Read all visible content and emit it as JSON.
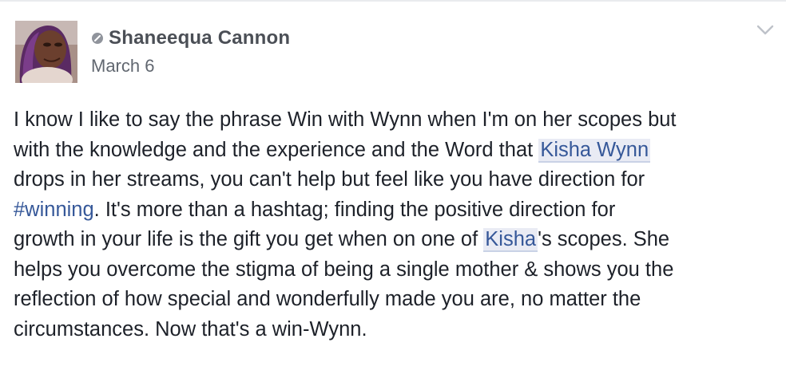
{
  "post": {
    "author_name": "Shaneequa Cannon",
    "date": "March 6",
    "avatar_icon": "profile-photo",
    "profile_badge_icon": "profile-badge-icon",
    "options_icon": "chevron-down-icon",
    "colors": {
      "text": "#1d2129",
      "author": "#4b4f56",
      "meta": "#616770",
      "link": "#365899",
      "mention_bg": "#e9ebf4"
    },
    "body": {
      "line1": "I know I like to say the phrase Win with Wynn when I'm on her scopes but",
      "line2_before": "with the knowledge and the experience and the Word that ",
      "mention_kisha_wynn": "Kisha Wynn",
      "line3": "drops in her streams, you can't help but feel like you have direction for",
      "hashtag_winning": "#winning",
      "line4_after": ". It's more than a hashtag; finding the positive direction for",
      "line5_before": "growth in your life is the gift you get when on one of ",
      "mention_kisha": "Kisha",
      "line5_after": "'s scopes. She",
      "line6": "helps you overcome the stigma of being a single mother & shows you the",
      "line7": "reflection of how special and wonderfully made you are, no matter the",
      "line8": "circumstances. Now that's a win-Wynn."
    }
  }
}
